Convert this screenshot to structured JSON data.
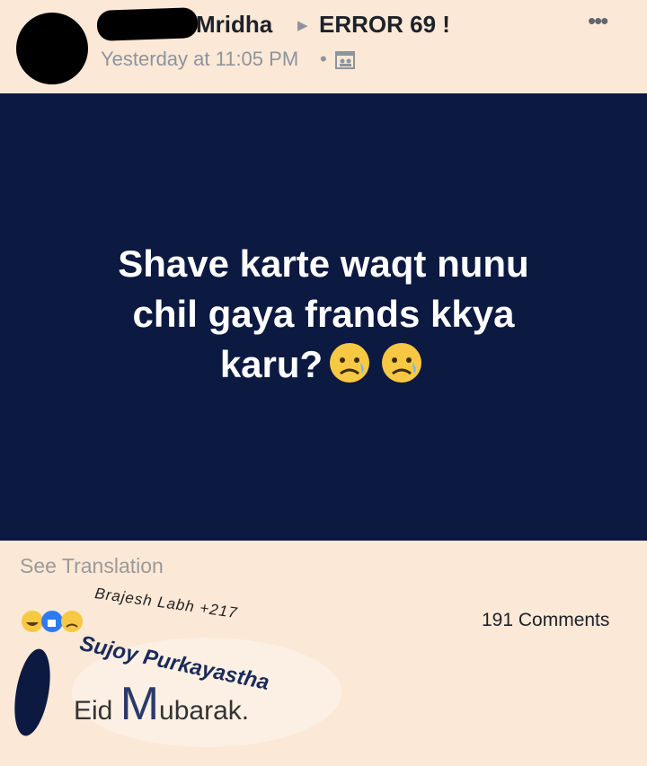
{
  "post": {
    "author_visible": "Mridha",
    "group": "ERROR 69 !",
    "timestamp": "Yesterday at 11:05 PM",
    "separator": "•",
    "body_lines": [
      "Shave karte waqt nunu",
      "chil gaya frands kkya",
      "karu?"
    ],
    "more_label": "•••"
  },
  "footer": {
    "see_translation": "See Translation",
    "reactors": "Brajesh Labh +217",
    "comments": "191 Comments"
  },
  "comment": {
    "author": "Sujoy Purkayastha",
    "text_prefix": "Eid ",
    "text_initial": "M",
    "text_rest": "ubarak."
  },
  "colors": {
    "background": "#fbe8d6",
    "post_bg": "#0c1941",
    "post_text": "#ffffff"
  },
  "icons": [
    "privacy-icon",
    "more-options-icon",
    "sad-emoji-icon",
    "haha-reaction-icon",
    "like-reaction-icon",
    "sad-reaction-icon"
  ]
}
